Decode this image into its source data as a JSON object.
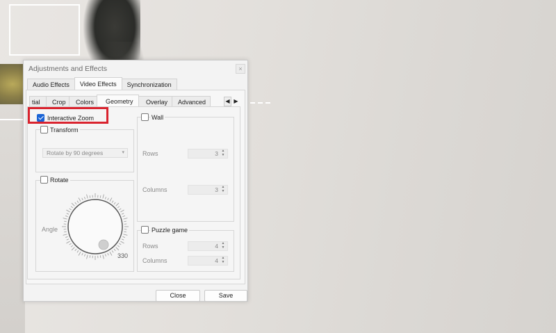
{
  "dialog": {
    "title": "Adjustments and Effects",
    "close_glyph": "×"
  },
  "main_tabs": [
    {
      "label": "Audio Effects",
      "active": false
    },
    {
      "label": "Video Effects",
      "active": true
    },
    {
      "label": "Synchronization",
      "active": false
    }
  ],
  "sub_tabs": [
    {
      "label": "tial",
      "active": false
    },
    {
      "label": "Crop",
      "active": false
    },
    {
      "label": "Colors",
      "active": false
    },
    {
      "label": "Geometry",
      "active": true
    },
    {
      "label": "Overlay",
      "active": false
    },
    {
      "label": "Advanced",
      "active": false
    }
  ],
  "tab_scroll": {
    "left": "◀",
    "right": "▶"
  },
  "interactive_zoom": {
    "label": "Interactive Zoom",
    "checked": true
  },
  "transform": {
    "label": "Transform",
    "checked": false,
    "select_value": "Rotate by 90 degrees",
    "caret": "▾"
  },
  "rotate": {
    "label": "Rotate",
    "checked": false,
    "angle_label": "Angle",
    "angle_value": "330"
  },
  "wall": {
    "label": "Wall",
    "checked": false,
    "rows_label": "Rows",
    "rows_value": "3",
    "columns_label": "Columns",
    "columns_value": "3"
  },
  "puzzle": {
    "label": "Puzzle game",
    "checked": false,
    "rows_label": "Rows",
    "rows_value": "4",
    "columns_label": "Columns",
    "columns_value": "4"
  },
  "spin_arrows": "▲\n▼",
  "buttons": {
    "close": "Close",
    "save": "Save"
  },
  "colors": {
    "highlight": "#d9232e",
    "checkbox_checked": "#1a64d6"
  }
}
